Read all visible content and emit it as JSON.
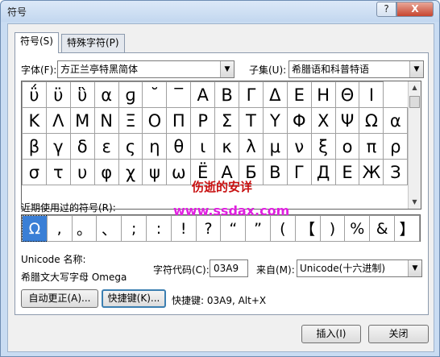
{
  "window": {
    "title": "符号",
    "help_glyph": "?",
    "close_glyph": "X"
  },
  "tabs": [
    {
      "label": "符号(S)"
    },
    {
      "label": "特殊字符(P)"
    }
  ],
  "font": {
    "label": "字体(F):",
    "value": "方正兰亭特黑简体"
  },
  "subset": {
    "label": "子集(U):",
    "value": "希腊语和科普特语"
  },
  "symbol_grid": [
    [
      "ΰ",
      "ϋ",
      "ὓ",
      "α",
      "ɡ",
      "˘",
      "‾",
      "Α",
      "Β",
      "Γ",
      "Δ",
      "Ε",
      "Η",
      "Θ",
      "Ι"
    ],
    [
      "Κ",
      "Λ",
      "Μ",
      "Ν",
      "Ξ",
      "Ο",
      "Π",
      "Ρ",
      "Σ",
      "Τ",
      "Υ",
      "Φ",
      "Χ",
      "Ψ",
      "Ω",
      "α"
    ],
    [
      "β",
      "γ",
      "δ",
      "ε",
      "ς",
      "η",
      "θ",
      "ι",
      "κ",
      "λ",
      "μ",
      "ν",
      "ξ",
      "ο",
      "π",
      "ρ"
    ],
    [
      "σ",
      "τ",
      "υ",
      "φ",
      "χ",
      "ψ",
      "ω",
      "Ё",
      "А",
      "Б",
      "В",
      "Г",
      "Д",
      "Е",
      "Ж",
      "З"
    ]
  ],
  "recent": {
    "label": "近期使用过的符号(R):",
    "symbols": [
      "Ω",
      ",",
      "。",
      "、",
      ";",
      ":",
      "!",
      "?",
      "“",
      "”",
      "(",
      "【",
      ")",
      "%",
      "&",
      "】"
    ]
  },
  "unicode_name": {
    "label": "Unicode 名称:",
    "value": "希腊文大写字母 Omega"
  },
  "char_code": {
    "label": "字符代码(C):",
    "value": "03A9"
  },
  "from": {
    "label": "来自(M):",
    "value": "Unicode(十六进制)"
  },
  "buttons": {
    "autocorrect": "自动更正(A)...",
    "shortcut": "快捷键(K)...",
    "insert": "插入(I)",
    "close": "关闭"
  },
  "shortcut_info": "快捷键: 03A9, Alt+X",
  "watermark": {
    "line1": "伤逝的安详",
    "line2": "www.ssdax.com"
  },
  "colors": {
    "selection": "#3a7fd6",
    "watermark1": "#c81010",
    "watermark2": "#e020e0"
  }
}
